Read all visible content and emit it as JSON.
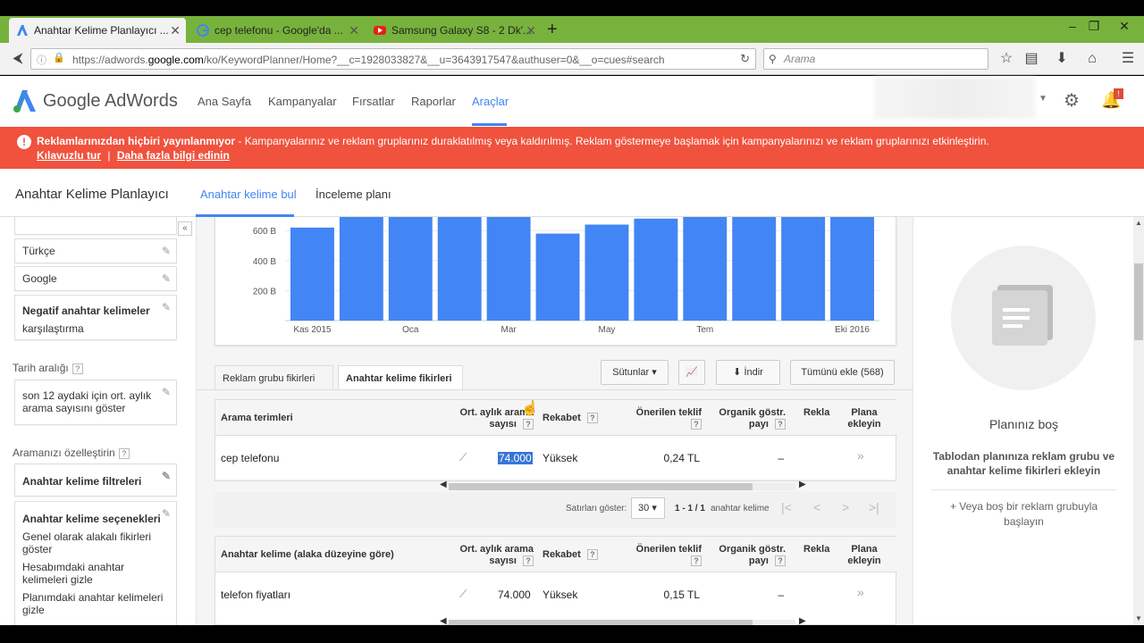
{
  "browser": {
    "tabs": [
      {
        "label": "Anahtar Kelime Planlayıcı ...",
        "icon": "adwords-icon"
      },
      {
        "label": "cep telefonu - Google'da ...",
        "icon": "google-icon"
      },
      {
        "label": "Samsung Galaxy S8 - 2 Dk'...",
        "icon": "youtube-icon"
      }
    ],
    "url_prefix": "https://adwords.",
    "url_domain": "google.com",
    "url_rest": "/ko/KeywordPlanner/Home?__c=1928033827&__u=3643917547&authuser=0&__o=cues#search",
    "search_placeholder": "Arama"
  },
  "header": {
    "logo": "Google AdWords",
    "nav": [
      "Ana Sayfa",
      "Kampanyalar",
      "Fırsatlar",
      "Raporlar",
      "Araçlar"
    ],
    "notification_count": "!"
  },
  "alert": {
    "bold": "Reklamlarınızdan hiçbiri yayınlanmıyor",
    "text": " - Kampanyalarınız ve reklam gruplarınız duraklatılmış veya kaldırılmış. Reklam göstermeye başlamak için kampanyalarınızı ve reklam gruplarınızı etkinleştirin.",
    "link1": "Kılavuzlu tur",
    "separator": "|",
    "link2": "Daha fazla bilgi edinin"
  },
  "subheader": {
    "title": "Anahtar Kelime Planlayıcı",
    "tab1": "Anahtar kelime bul",
    "tab2": "İnceleme planı"
  },
  "left": {
    "language": "Türkçe",
    "network": "Google",
    "negative_title": "Negatif anahtar kelimeler",
    "negative_value": "karşılaştırma",
    "date_range_label": "Tarih aralığı",
    "date_range_value": "son 12 aydaki için ort. aylık arama sayısını göster",
    "customize_label": "Aramanızı özelleştirin",
    "filters": "Anahtar kelime filtreleri",
    "options_title": "Anahtar kelime seçenekleri",
    "options": [
      "Genel olarak alakalı fikirleri göster",
      "Hesabımdaki anahtar kelimeleri gizle",
      "Planımdaki anahtar kelimeleri gizle"
    ]
  },
  "chart_data": {
    "type": "bar",
    "title": "",
    "ylabel": "",
    "y_ticks": [
      "600 B",
      "400 B",
      "200 B"
    ],
    "x_ticks": [
      "Kas 2015",
      "Oca",
      "Mar",
      "May",
      "Tem",
      "Eki 2016"
    ],
    "values": [
      620,
      750,
      750,
      750,
      750,
      580,
      640,
      680,
      700,
      750,
      750,
      750
    ],
    "ylim": [
      0,
      700
    ],
    "color": "#4285f4"
  },
  "tools": {
    "subtab1": "Reklam grubu fikirleri",
    "subtab2": "Anahtar kelime fikirleri",
    "columns": "Sütunlar",
    "download": "İndir",
    "add_all": "Tümünü ekle (568)"
  },
  "table1": {
    "headers": [
      "Arama terimleri",
      "Ort. aylık arama sayısı",
      "Rekabet",
      "Önerilen teklif",
      "Organik göstr. payı",
      "Rekla",
      "Plana ekleyin"
    ],
    "row": {
      "term": "cep telefonu",
      "searches": "74.000",
      "competition": "Yüksek",
      "bid": "0,24 TL",
      "organic": "–",
      "add": "»"
    }
  },
  "pager": {
    "rows_label": "Satırları göster:",
    "rows_value": "30",
    "range": "1 - 1 / 1",
    "range_suffix": "anahtar kelime"
  },
  "table2": {
    "headers": [
      "Anahtar kelime (alaka düzeyine göre)",
      "Ort. aylık arama sayısı",
      "Rekabet",
      "Önerilen teklif",
      "Organik göstr. payı",
      "Rekla",
      "Plana ekleyin"
    ],
    "row": {
      "term": "telefon fiyatları",
      "searches": "74.000",
      "competition": "Yüksek",
      "bid": "0,15 TL",
      "organic": "–",
      "add": "»"
    }
  },
  "right": {
    "empty_title": "Planınız boş",
    "empty_desc": "Tablodan planınıza reklam grubu ve anahtar kelime fikirleri ekleyin",
    "empty_link": "+ Veya boş bir reklam grubuyla başlayın"
  }
}
